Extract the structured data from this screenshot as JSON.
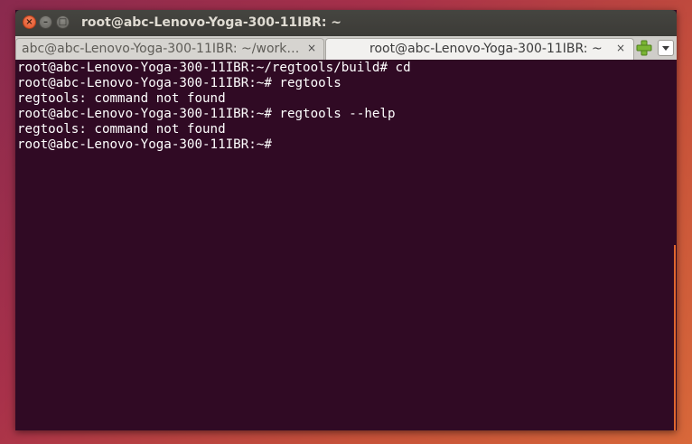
{
  "window": {
    "title": "root@abc-Lenovo-Yoga-300-11IBR: ~"
  },
  "tabs": [
    {
      "label": "abc@abc-Lenovo-Yoga-300-11IBR: ~/works…",
      "close": "×",
      "active": false
    },
    {
      "label": "root@abc-Lenovo-Yoga-300-11IBR: ~",
      "close": "×",
      "active": true
    }
  ],
  "icons": {
    "close": "close-icon",
    "minimize": "minimize-icon",
    "maximize": "maximize-icon",
    "new_tab": "plus-icon",
    "tab_menu": "chevron-down-icon",
    "close_glyph": "×",
    "minimize_glyph": "–",
    "maximize_glyph": "□"
  },
  "colors": {
    "terminal_bg": "#300a24",
    "terminal_fg": "#ffffff",
    "close_button": "#e0552b",
    "new_tab_plus": "#7ab534",
    "scrollbar_thumb": "#e0672e"
  },
  "terminal": {
    "lines": [
      "root@abc-Lenovo-Yoga-300-11IBR:~/regtools/build# cd",
      "root@abc-Lenovo-Yoga-300-11IBR:~# regtools",
      "regtools: command not found",
      "root@abc-Lenovo-Yoga-300-11IBR:~# regtools --help",
      "regtools: command not found",
      "root@abc-Lenovo-Yoga-300-11IBR:~#"
    ]
  },
  "scrollbar": {
    "position_fraction": 0.5,
    "visible_fraction": 0.5
  }
}
